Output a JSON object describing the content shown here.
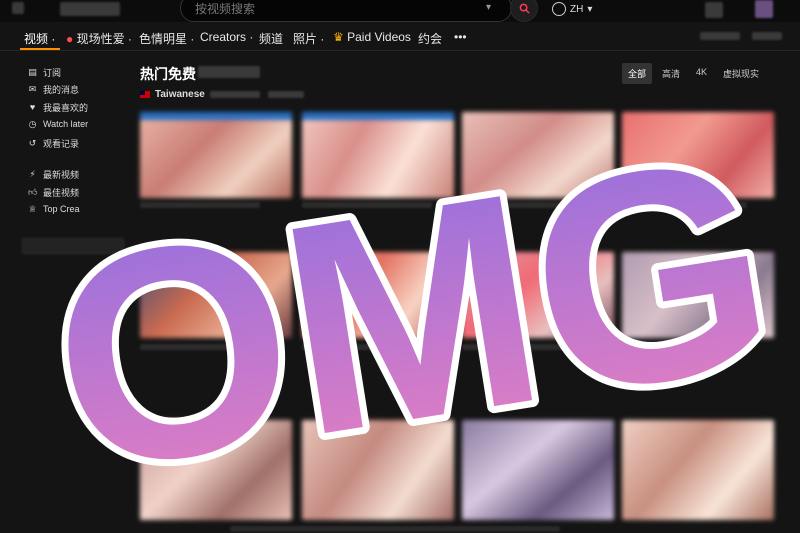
{
  "header": {
    "search_placeholder": "按视频搜索",
    "language": "ZH"
  },
  "nav": {
    "items": [
      {
        "label": "视频 ·",
        "id": "videos"
      },
      {
        "label": "现场性爱 ·",
        "id": "live-sex"
      },
      {
        "label": "色情明星 ·",
        "id": "pornstars"
      },
      {
        "label": "Creators ·",
        "id": "creators"
      },
      {
        "label": "频道",
        "id": "channels"
      },
      {
        "label": "照片 ·",
        "id": "photos"
      },
      {
        "label": "Paid Videos",
        "id": "paid-videos"
      },
      {
        "label": "约会",
        "id": "dating"
      },
      {
        "label": "•••",
        "id": "more"
      }
    ],
    "accent_color": "#ff9000"
  },
  "sidebar": {
    "items": [
      {
        "label": "订阅",
        "icon": "subscriptions-icon"
      },
      {
        "label": "我的消息",
        "icon": "messages-icon"
      },
      {
        "label": "我最喜欢的",
        "icon": "heart-icon"
      },
      {
        "label": "Watch later",
        "icon": "clock-icon"
      },
      {
        "label": "观看记录",
        "icon": "history-icon"
      },
      {
        "label": "最新视频",
        "icon": "lightning-icon"
      },
      {
        "label": "最佳视频",
        "icon": "thumbs-up-icon"
      },
      {
        "label": "Top Crea",
        "icon": "trophy-icon"
      }
    ]
  },
  "main": {
    "section_title": "热门免费",
    "subtitle": "Taiwanese",
    "filters": [
      "全部",
      "高清",
      "4K",
      "虚拟现实"
    ],
    "active_filter": "全部"
  },
  "overlay": {
    "text": "OMG",
    "gradient_top": "#8f6fe0",
    "gradient_bottom": "#e97fc0",
    "stroke_color": "#ffffff"
  }
}
